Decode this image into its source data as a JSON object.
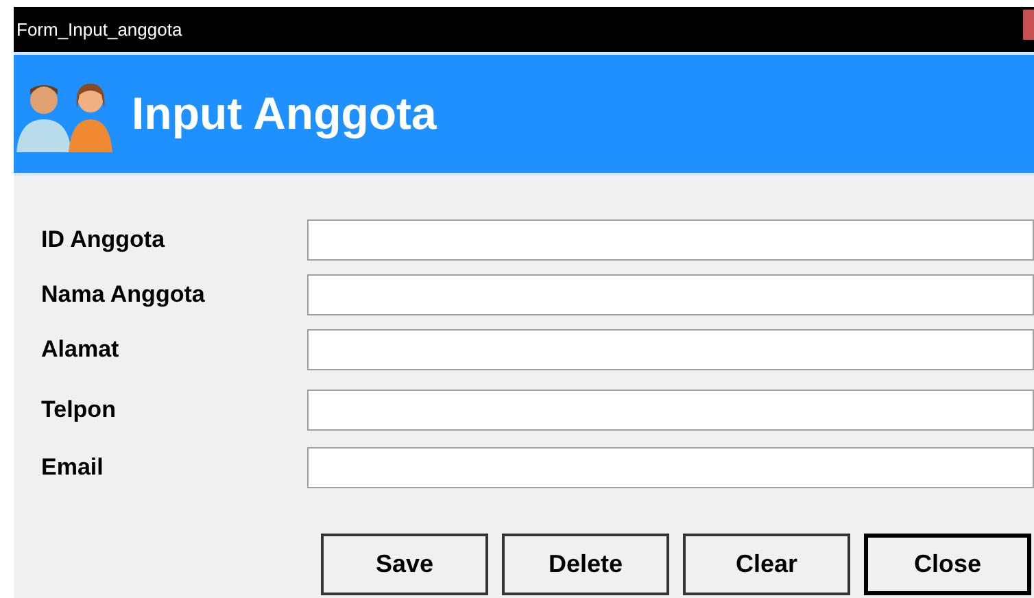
{
  "window": {
    "title": "Form_Input_anggota"
  },
  "header": {
    "title": "Input Anggota"
  },
  "fields": [
    {
      "label": "ID Anggota"
    },
    {
      "label": "Nama Anggota"
    },
    {
      "label": "Alamat"
    },
    {
      "label": "Telpon"
    },
    {
      "label": "Email"
    }
  ],
  "buttons": [
    {
      "label": "Save",
      "default": false
    },
    {
      "label": "Delete",
      "default": false
    },
    {
      "label": "Clear",
      "default": false
    },
    {
      "label": "Close",
      "default": true
    }
  ]
}
